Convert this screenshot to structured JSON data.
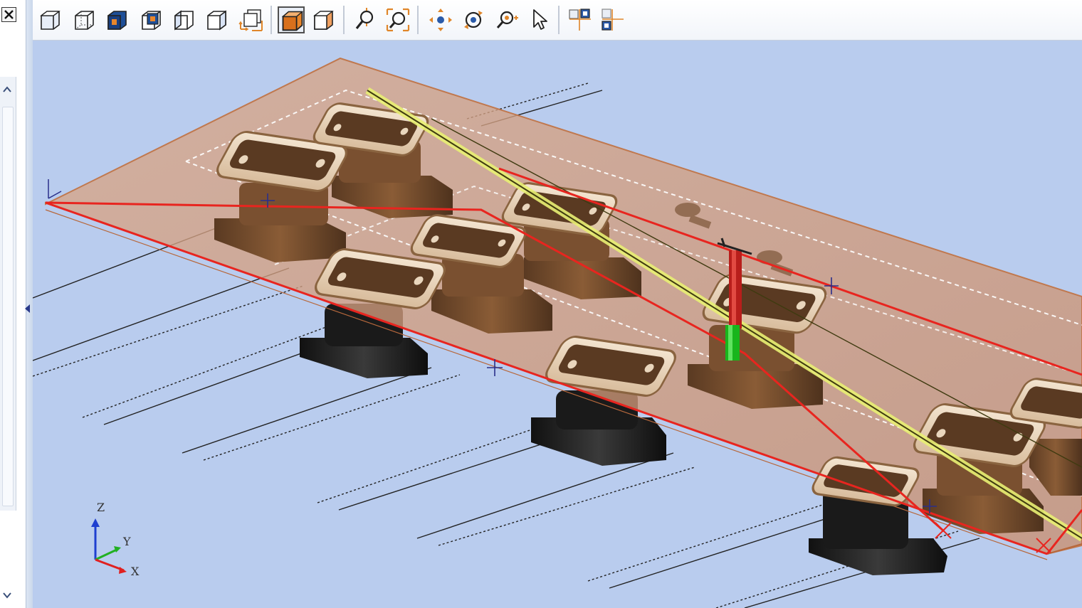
{
  "toolbar": {
    "tools": [
      {
        "name": "iso-view-icon"
      },
      {
        "name": "wireframe-view-icon"
      },
      {
        "name": "front-view-icon"
      },
      {
        "name": "back-view-icon"
      },
      {
        "name": "left-view-icon"
      },
      {
        "name": "right-view-icon"
      },
      {
        "name": "top-view-icon"
      },
      {
        "name": "shaded-view-icon",
        "active": true
      },
      {
        "name": "hidden-line-view-icon"
      },
      {
        "name": "zoom-icon"
      },
      {
        "name": "zoom-fit-icon"
      },
      {
        "name": "pan-icon"
      },
      {
        "name": "rotate-icon"
      },
      {
        "name": "zoom-window-icon"
      },
      {
        "name": "select-pointer-icon"
      },
      {
        "name": "layout-split-icon"
      },
      {
        "name": "layout-single-icon"
      }
    ]
  },
  "viewport": {
    "background_color": "#b9ccee",
    "axes": {
      "x_label": "X",
      "y_label": "Y",
      "z_label": "Z"
    }
  },
  "colors": {
    "plate": "#d9a889",
    "plate_edge": "#c0784e",
    "path_red": "#e8251f",
    "path_yellow": "#e8ef73",
    "bronze": "#7a5030",
    "black_base": "#1c1c1c"
  }
}
